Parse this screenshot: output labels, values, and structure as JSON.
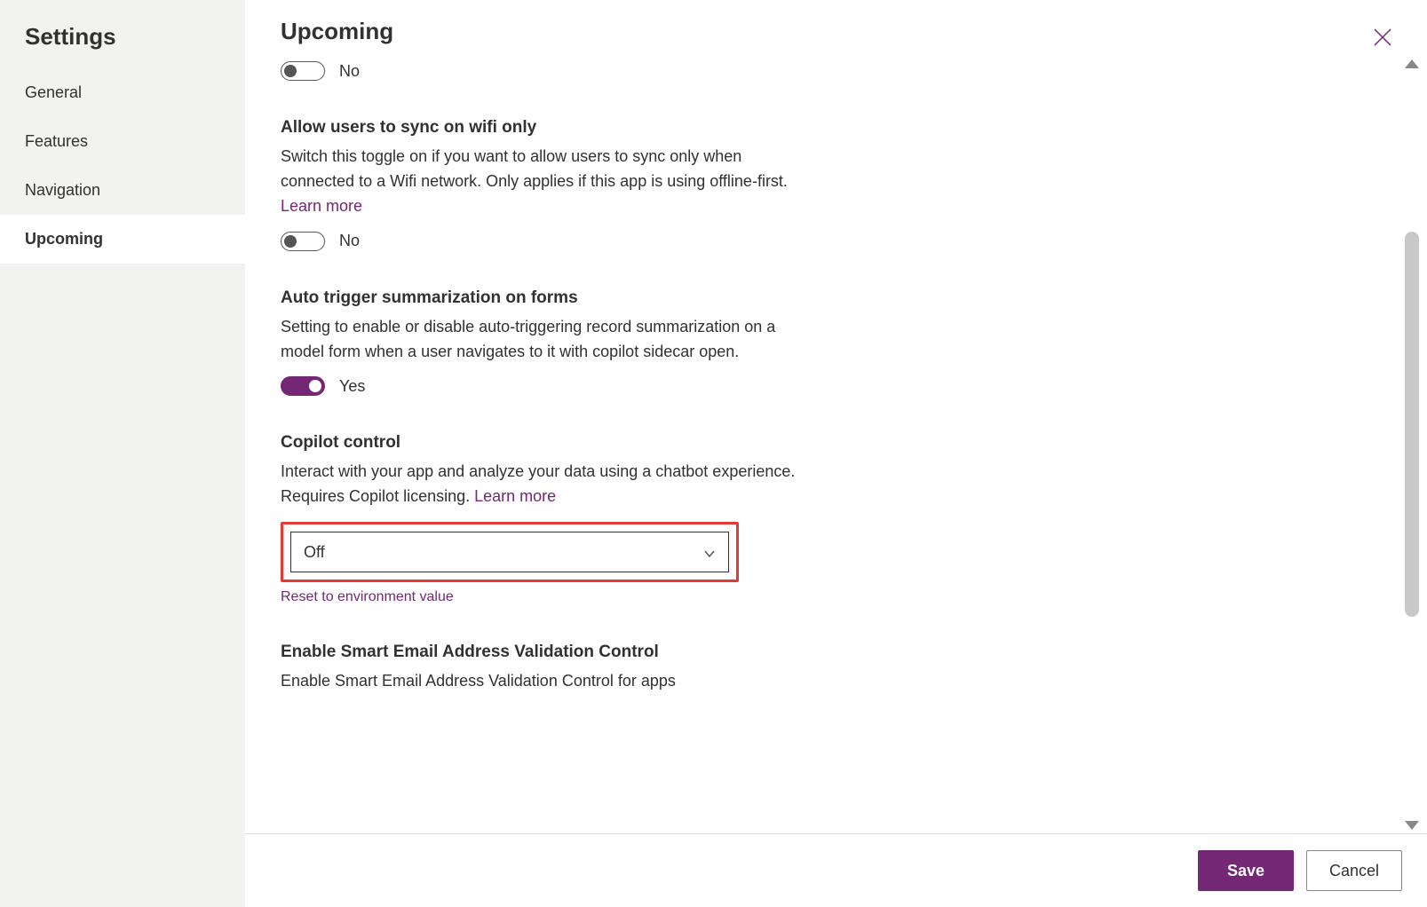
{
  "sidebar": {
    "title": "Settings",
    "items": [
      {
        "label": "General",
        "active": false
      },
      {
        "label": "Features",
        "active": false
      },
      {
        "label": "Navigation",
        "active": false
      },
      {
        "label": "Upcoming",
        "active": true
      }
    ]
  },
  "header": {
    "title": "Upcoming"
  },
  "settings": {
    "s0": {
      "toggle_state": "off",
      "toggle_label": "No"
    },
    "s1": {
      "title": "Allow users to sync on wifi only",
      "desc": "Switch this toggle on if you want to allow users to sync only when connected to a Wifi network. Only applies if this app is using offline-first. ",
      "learn_more": "Learn more",
      "toggle_state": "off",
      "toggle_label": "No"
    },
    "s2": {
      "title": "Auto trigger summarization on forms",
      "desc": "Setting to enable or disable auto-triggering record summarization on a model form when a user navigates to it with copilot sidecar open.",
      "toggle_state": "on",
      "toggle_label": "Yes"
    },
    "s3": {
      "title": "Copilot control",
      "desc": "Interact with your app and analyze your data using a chatbot experience. Requires Copilot licensing. ",
      "learn_more": "Learn more",
      "select_value": "Off",
      "reset_link": "Reset to environment value"
    },
    "s4": {
      "title": "Enable Smart Email Address Validation Control",
      "desc": "Enable Smart Email Address Validation Control for apps"
    }
  },
  "footer": {
    "save": "Save",
    "cancel": "Cancel"
  }
}
